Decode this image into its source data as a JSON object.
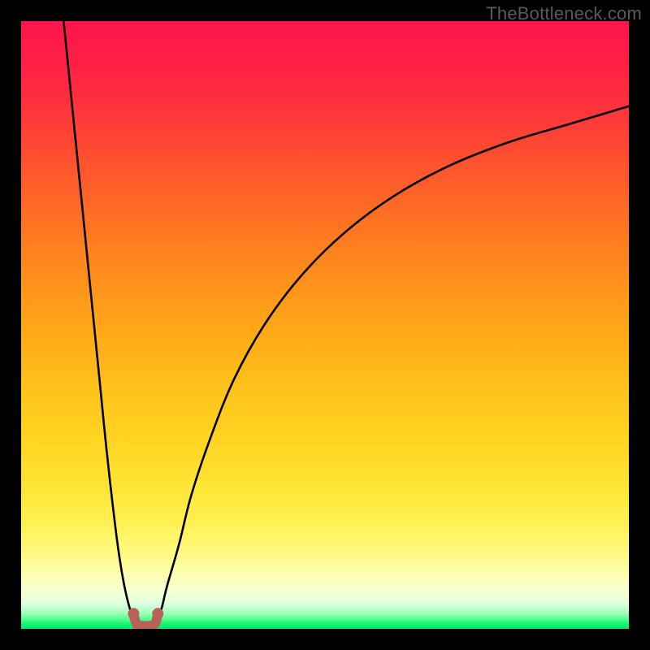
{
  "watermark": "TheBottleneck.com",
  "chart_data": {
    "type": "line",
    "title": "",
    "xlabel": "",
    "ylabel": "",
    "xlim": [
      0,
      100
    ],
    "ylim": [
      0,
      100
    ],
    "grid": false,
    "legend_position": "none",
    "background": "red-yellow-green vertical gradient",
    "annotations": [
      {
        "text": "TheBottleneck.com",
        "position": "top-right",
        "color": "#5a5a5a"
      }
    ],
    "series": [
      {
        "name": "left-branch",
        "x": [
          7,
          8,
          9,
          10,
          11,
          12,
          13,
          14,
          15,
          16,
          17,
          18,
          19
        ],
        "y": [
          100,
          90,
          80,
          70,
          60,
          50,
          40,
          30,
          21,
          13,
          7,
          3,
          1
        ]
      },
      {
        "name": "right-branch",
        "x": [
          22,
          23,
          24,
          26,
          28,
          31,
          35,
          40,
          46,
          53,
          61,
          70,
          80,
          90,
          100
        ],
        "y": [
          1,
          3,
          7,
          14,
          22,
          31,
          41,
          50,
          58,
          65,
          71,
          76,
          80,
          83,
          86
        ]
      },
      {
        "name": "valley-marker",
        "x": [
          18.5,
          19,
          20,
          21,
          22,
          22.5
        ],
        "y": [
          2.5,
          0.8,
          0.5,
          0.5,
          0.8,
          2.5
        ],
        "style": "thick-rose"
      }
    ],
    "notes": "Values are approximate, read from an unlabeled plot region inside a 748x748 inner frame. x and y are expressed as percentages across the plot area (0 = left/bottom, 100 = right/top). The curve forms a sharp V with its minimum near x≈20%, y≈0%; the left branch descends steeply from the top-left, the right branch rises with diminishing slope toward the upper right. A short rose-colored U-segment marks the valley floor."
  }
}
